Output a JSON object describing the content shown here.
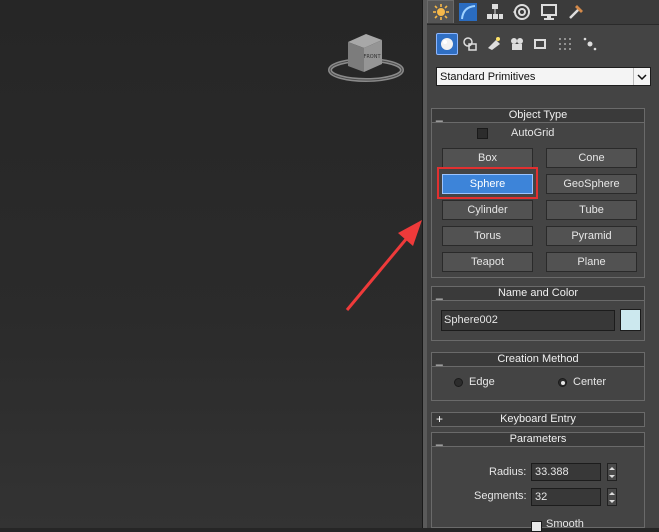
{
  "command_panel": {
    "tabs": [
      {
        "icon": "create-icon"
      },
      {
        "icon": "modify-icon"
      },
      {
        "icon": "hierarchy-icon"
      },
      {
        "icon": "motion-icon"
      },
      {
        "icon": "display-icon"
      },
      {
        "icon": "utilities-icon"
      }
    ],
    "create_categories": [
      {
        "icon": "geometry-icon"
      },
      {
        "icon": "shapes-icon"
      },
      {
        "icon": "lights-icon"
      },
      {
        "icon": "cameras-icon"
      },
      {
        "icon": "helpers-icon"
      },
      {
        "icon": "space-warps-icon"
      },
      {
        "icon": "systems-icon"
      }
    ],
    "dropdown_value": "Standard Primitives"
  },
  "object_type": {
    "title": "Object Type",
    "collapse_sign": "_",
    "autogrid_label": "AutoGrid",
    "buttons": [
      "Box",
      "Cone",
      "Sphere",
      "GeoSphere",
      "Cylinder",
      "Tube",
      "Torus",
      "Pyramid",
      "Teapot",
      "Plane"
    ],
    "active": "Sphere"
  },
  "name_and_color": {
    "title": "Name and Color",
    "collapse_sign": "_",
    "name_value": "Sphere002",
    "swatch_color": "#cce8ee"
  },
  "creation_method": {
    "title": "Creation Method",
    "collapse_sign": "_",
    "options": [
      "Edge",
      "Center"
    ],
    "selected": "Center"
  },
  "keyboard_entry": {
    "title": "Keyboard Entry",
    "collapse_sign": "+"
  },
  "parameters": {
    "title": "Parameters",
    "collapse_sign": "_",
    "radius_label": "Radius:",
    "radius_value": "33.388",
    "segments_label": "Segments:",
    "segments_value": "32",
    "smooth_label": "Smooth"
  },
  "viewcube": {
    "face_label": "FRONT"
  },
  "colors": {
    "accent": "#3d84d9",
    "highlight": "#e13030",
    "annotation_arrow": "#ee3a3a"
  }
}
